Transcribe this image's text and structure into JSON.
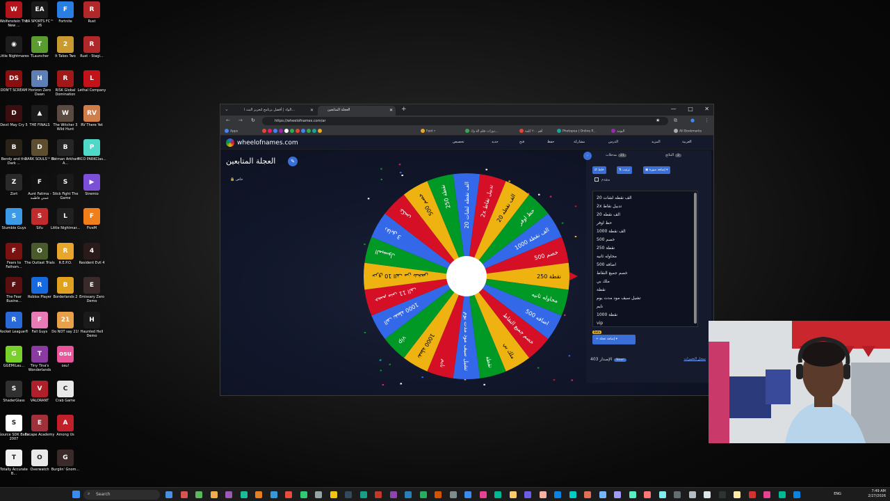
{
  "desktop_icons": [
    {
      "label": "Wolfenstein The New ...",
      "color": "#b1151b",
      "glyph": "W",
      "col": 0,
      "row": 0
    },
    {
      "label": "EA SPORTS FC™ 26",
      "color": "#1a1a1a",
      "glyph": "EA",
      "col": 1,
      "row": 0
    },
    {
      "label": "Fortnite",
      "color": "#2a7de1",
      "glyph": "F",
      "col": 2,
      "row": 0
    },
    {
      "label": "Rust",
      "color": "#b0282a",
      "glyph": "R",
      "col": 3,
      "row": 0
    },
    {
      "label": "Little Nightmares",
      "color": "#1d1d1d",
      "glyph": "◉",
      "col": 0,
      "row": 1
    },
    {
      "label": "TLauncher",
      "color": "#5a9c2f",
      "glyph": "T",
      "col": 1,
      "row": 1
    },
    {
      "label": "It Takes Two",
      "color": "#c99a30",
      "glyph": "2",
      "col": 2,
      "row": 1
    },
    {
      "label": "Rust - Stagi...",
      "color": "#b0282a",
      "glyph": "R",
      "col": 3,
      "row": 1
    },
    {
      "label": "DON'T SCREAM",
      "color": "#8a1010",
      "glyph": "DS",
      "col": 0,
      "row": 2
    },
    {
      "label": "Horizon Zero Dawn",
      "color": "#5d7fb5",
      "glyph": "H",
      "col": 1,
      "row": 2
    },
    {
      "label": "RISK Global Domination",
      "color": "#a11818",
      "glyph": "R",
      "col": 2,
      "row": 2
    },
    {
      "label": "Lethal Company",
      "color": "#c4121a",
      "glyph": "L",
      "col": 3,
      "row": 2
    },
    {
      "label": "Devil May Cry 5",
      "color": "#3b0f0f",
      "glyph": "D",
      "col": 0,
      "row": 3
    },
    {
      "label": "THE FINALS",
      "color": "#1b1b1b",
      "glyph": "▲",
      "col": 1,
      "row": 3
    },
    {
      "label": "The Witcher 3 Wild Hunt",
      "color": "#5a4a40",
      "glyph": "W",
      "col": 2,
      "row": 3
    },
    {
      "label": "RV There Yet",
      "color": "#d17d4a",
      "glyph": "RV",
      "col": 3,
      "row": 3
    },
    {
      "label": "Bendy and the Dark ...",
      "color": "#2b2318",
      "glyph": "B",
      "col": 0,
      "row": 4
    },
    {
      "label": "DARK SOULS™ III",
      "color": "#5d4e2f",
      "glyph": "D",
      "col": 1,
      "row": 4
    },
    {
      "label": "Batman Arkham A...",
      "color": "#262626",
      "glyph": "B",
      "col": 2,
      "row": 4
    },
    {
      "label": "PICO PARKClas...",
      "color": "#4fd7c8",
      "glyph": "P",
      "col": 3,
      "row": 4
    },
    {
      "label": "Zort",
      "color": "#2a2a2a",
      "glyph": "Z",
      "col": 0,
      "row": 5
    },
    {
      "label": "Aunt Fatima - عمتي فاطمة",
      "color": "#111",
      "glyph": "F",
      "col": 1,
      "row": 5
    },
    {
      "label": "Stick Fight The Game",
      "color": "#1a1a1a",
      "glyph": "S",
      "col": 2,
      "row": 5
    },
    {
      "label": "Stremio",
      "color": "#7b4fd8",
      "glyph": "▶",
      "col": 3,
      "row": 5
    },
    {
      "label": "Stumble Guys",
      "color": "#3c9be8",
      "glyph": "S",
      "col": 0,
      "row": 6
    },
    {
      "label": "Sifu",
      "color": "#c22b2b",
      "glyph": "S",
      "col": 1,
      "row": 6
    },
    {
      "label": "Little Nightmar...",
      "color": "#202020",
      "glyph": "L",
      "col": 2,
      "row": 6
    },
    {
      "label": "FiveM",
      "color": "#f07e1b",
      "glyph": "F",
      "col": 3,
      "row": 6
    },
    {
      "label": "Fears to Fathom...",
      "color": "#7a1212",
      "glyph": "F",
      "col": 0,
      "row": 7
    },
    {
      "label": "The Outlast Trials",
      "color": "#4a5a2a",
      "glyph": "O",
      "col": 1,
      "row": 7
    },
    {
      "label": "R.E.P.O.",
      "color": "#e8a62a",
      "glyph": "R",
      "col": 2,
      "row": 7
    },
    {
      "label": "Resident Evil 4",
      "color": "#2b1a1a",
      "glyph": "4",
      "col": 3,
      "row": 7
    },
    {
      "label": "The Fear Busine...",
      "color": "#5a1010",
      "glyph": "F",
      "col": 0,
      "row": 8
    },
    {
      "label": "Roblox Player",
      "color": "#1769e0",
      "glyph": "R",
      "col": 1,
      "row": 8
    },
    {
      "label": "Borderlands 2",
      "color": "#e0a020",
      "glyph": "B",
      "col": 2,
      "row": 8
    },
    {
      "label": "Emissary Zero Demo",
      "color": "#3a2a2a",
      "glyph": "E",
      "col": 3,
      "row": 8
    },
    {
      "label": "Rocket League®",
      "color": "#2a6ad8",
      "glyph": "R",
      "col": 0,
      "row": 9
    },
    {
      "label": "Fall Guys",
      "color": "#e87ab5",
      "glyph": "F",
      "col": 1,
      "row": 9
    },
    {
      "label": "Do NOT say 21!",
      "color": "#e8a04a",
      "glyph": "21",
      "col": 2,
      "row": 9
    },
    {
      "label": "Haunted Hell Demo",
      "color": "#1a1a1a",
      "glyph": "H",
      "col": 3,
      "row": 9
    },
    {
      "label": "GGEMILau...",
      "color": "#7ad02a",
      "glyph": "G",
      "col": 0,
      "row": 10
    },
    {
      "label": "Tiny Tina's Wonderlands",
      "color": "#8a3aa0",
      "glyph": "T",
      "col": 1,
      "row": 10
    },
    {
      "label": "osu!",
      "color": "#e8559a",
      "glyph": "osu",
      "col": 2,
      "row": 10
    },
    {
      "label": "ShaderGlass",
      "color": "#303030",
      "glyph": "S",
      "col": 0,
      "row": 11
    },
    {
      "label": "VALORANT",
      "color": "#b0202a",
      "glyph": "V",
      "col": 1,
      "row": 11
    },
    {
      "label": "Crab Game",
      "color": "#e8e8e8",
      "glyph": "C",
      "col": 2,
      "row": 11
    },
    {
      "label": "Source SDK Base 2007",
      "color": "#ffffff",
      "glyph": "S",
      "col": 0,
      "row": 12
    },
    {
      "label": "Escape Academy",
      "color": "#a0303a",
      "glyph": "E",
      "col": 1,
      "row": 12
    },
    {
      "label": "Among Us",
      "color": "#c0202a",
      "glyph": "A",
      "col": 2,
      "row": 12
    },
    {
      "label": "Totally Accurate B...",
      "color": "#f0f0f0",
      "glyph": "T",
      "col": 0,
      "row": 13
    },
    {
      "label": "Overwatch",
      "color": "#e8e8e8",
      "glyph": "O",
      "col": 1,
      "row": 13
    },
    {
      "label": "Burglin' Gnom...",
      "color": "#3a2a2a",
      "glyph": "G",
      "col": 2,
      "row": 13
    }
  ],
  "browser": {
    "tabs": [
      {
        "title": "الواد | أفضل برنامج لتعزيز البث ا..."
      },
      {
        "title": "العجلة المتابعين"
      }
    ],
    "new_tab": "+",
    "window_controls": {
      "min": "—",
      "max": "□",
      "close": "✕"
    },
    "url": "https://wheelofnames.com/ar",
    "bookmarks": [
      {
        "label": "Apps",
        "color": "#4285f4"
      },
      {
        "label": "Feid •",
        "color": "#e8a62a"
      },
      {
        "label": "دورات تعلم الة وك...",
        "color": "#34a853"
      },
      {
        "label": "أهم ٣٠٠ كلمة",
        "color": "#ea4335"
      },
      {
        "label": "Photopea | Online P...",
        "color": "#18a497"
      },
      {
        "label": "اليوتيد",
        "color": "#9c27b0"
      },
      {
        "label": "All Bookmarks",
        "color": "#aaaaaa"
      }
    ]
  },
  "site": {
    "logo": "wheelofnames.com",
    "menu": [
      "العربية",
      "المزيد",
      "الدرس",
      "مشاركة",
      "حفظ",
      "فتح",
      "جديد",
      "تخصيص"
    ],
    "wheel_title": "العجلة المتابعين",
    "edit_icon": "pencil-icon",
    "share_label": "خاص"
  },
  "panel": {
    "tab_entries": {
      "label": "مدخلات",
      "count": "21"
    },
    "tab_results": {
      "label": "النتائج",
      "count": "2"
    },
    "shuffle_label": "خلط",
    "sort_label": "ترتيب",
    "add_image_label": "إضافة صورة",
    "advanced_label": "متقدم",
    "entries": [
      "الف نقطه لشات 20",
      "2x تدبيل نقاط",
      "الف نقطه 20",
      "حظ اوفر",
      "الف نقطة 1000",
      "خصم 500",
      "نقطة 250",
      "محاوله ثانيه",
      "اضافه 500",
      "خصم جميع النقاط",
      "ملك بي",
      "نقطة",
      "تشيل سيف مود مدت يوم",
      "نايم",
      "نقطة 1000",
      "vip"
    ],
    "add_wheel_label": "إضافة عجلة",
    "beta": "Beta",
    "results_count_label": "الإصدار 403",
    "new_badge": "New!",
    "changelog_label": "سجل التغييرات"
  },
  "wheel": {
    "colors": [
      "#3369e8",
      "#d50f25",
      "#eeb211",
      "#009925"
    ],
    "segments": [
      "الف نقطه لشات 20",
      "2x تدبيل نقاط",
      "الف نقطه 20",
      "حظ اوفر",
      "الف نقطة 1000",
      "خصم 500",
      "نقطة 250",
      "محاوله ثانيه",
      "اضافه 500",
      "خصم جميع النقاط",
      "ملك بي",
      "نقطة",
      "تشيل سيف مود مدت يوم",
      "نايم",
      "نقطة 1000",
      "vip",
      "الف نقطة 1000",
      "خصم منى 11 الف",
      "حرق 10 الف من شخص",
      "الميسول",
      "3 دقايق",
      "عكس",
      "خصم 500",
      "250 نقطة"
    ]
  },
  "taskbar": {
    "search_placeholder": "Search",
    "lang": "ENG",
    "time": "7:49 AM",
    "date": "2/27/2026"
  }
}
